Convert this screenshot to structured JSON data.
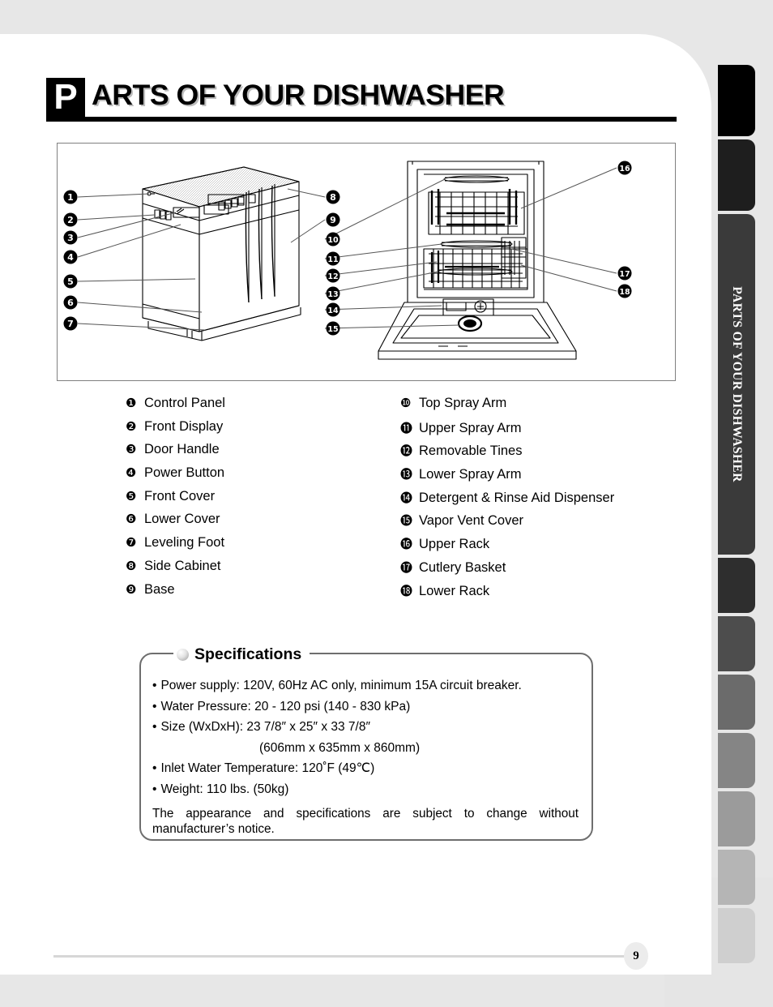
{
  "heading": {
    "badge_letter": "P",
    "text": "ARTS OF YOUR DISHWASHER"
  },
  "sidebar": {
    "active_tab_label": "PARTS OF YOUR DISHWASHER",
    "tabs": [
      {
        "label": "",
        "color": "#000000"
      },
      {
        "label": "",
        "color": "#1e1e1e"
      },
      {
        "label": "PARTS OF YOUR DISHWASHER",
        "color": "#3a3a3a"
      },
      {
        "label": "",
        "color": "#2e2e2e"
      },
      {
        "label": "",
        "color": "#4d4d4d"
      },
      {
        "label": "",
        "color": "#6b6b6b"
      },
      {
        "label": "",
        "color": "#858585"
      },
      {
        "label": "",
        "color": "#9b9b9b"
      },
      {
        "label": "",
        "color": "#b5b5b5"
      },
      {
        "label": "",
        "color": "#cfcfcf"
      }
    ]
  },
  "figure": {
    "callouts_front": [
      "1",
      "2",
      "3",
      "4",
      "5",
      "6",
      "7"
    ],
    "callouts_middle": [
      "8",
      "9",
      "10",
      "11",
      "12",
      "13",
      "14",
      "15"
    ],
    "callouts_right": [
      "16",
      "17",
      "18"
    ]
  },
  "parts_list": {
    "left": [
      {
        "num": "❶",
        "label": "Control Panel"
      },
      {
        "num": "❷",
        "label": "Front Display"
      },
      {
        "num": "❸",
        "label": "Door Handle"
      },
      {
        "num": "❹",
        "label": "Power Button"
      },
      {
        "num": "❺",
        "label": "Front Cover"
      },
      {
        "num": "❻",
        "label": "Lower Cover"
      },
      {
        "num": "❼",
        "label": "Leveling Foot"
      },
      {
        "num": "❽",
        "label": "Side Cabinet"
      },
      {
        "num": "❾",
        "label": "Base"
      }
    ],
    "right": [
      {
        "num": "❿",
        "label": "Top Spray Arm"
      },
      {
        "num": "⓫",
        "label": "Upper Spray Arm"
      },
      {
        "num": "⓬",
        "label": "Removable Tines"
      },
      {
        "num": "⓭",
        "label": "Lower Spray Arm"
      },
      {
        "num": "⓮",
        "label": "Detergent & Rinse Aid Dispenser"
      },
      {
        "num": "⓯",
        "label": "Vapor Vent Cover"
      },
      {
        "num": "⓰",
        "label": "Upper Rack"
      },
      {
        "num": "⓱",
        "label": "Cutlery Basket"
      },
      {
        "num": "⓲",
        "label": "Lower Rack"
      }
    ]
  },
  "specifications": {
    "title": "Specifications",
    "items": [
      "Power supply: 120V, 60Hz AC only, minimum 15A circuit breaker.",
      "Water Pressure: 20 - 120 psi (140 - 830 kPa)",
      "Size (WxDxH): 23 7/8″ x 25″ x 33 7/8″",
      "(606mm x 635mm x 860mm)",
      "Inlet Water Temperature: 120˚F (49℃)",
      "Weight: 110 lbs. (50kg)"
    ],
    "note": "The appearance and specifications are subject to change without manufacturer’s notice."
  },
  "footer": {
    "page_number": "9"
  }
}
